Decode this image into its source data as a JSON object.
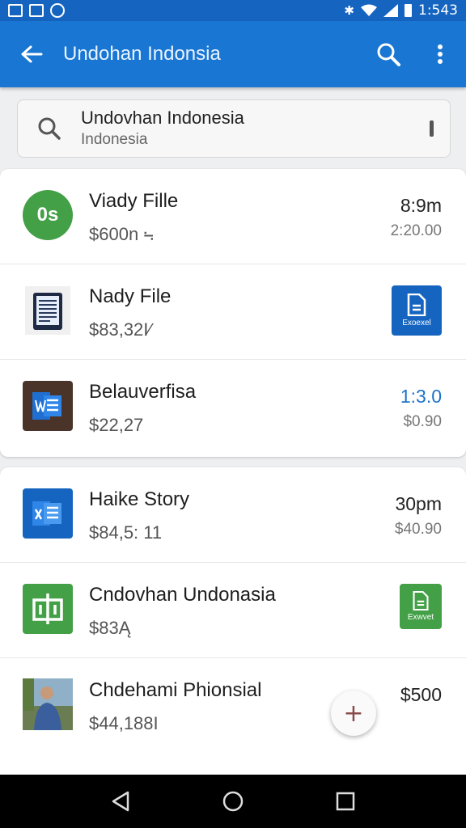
{
  "status_bar": {
    "time": "1:543",
    "left_icons": [
      "gallery-icon",
      "photo-icon",
      "app-icon"
    ],
    "right_icons": [
      "bluetooth-icon",
      "wifi-icon",
      "signal-icon",
      "battery-icon"
    ]
  },
  "app_bar": {
    "title": "Undohan Indonsia",
    "color": "#1976d2"
  },
  "search": {
    "query": "Undovhan Indonesia",
    "subtitle": "Indonesia"
  },
  "list_1": [
    {
      "title": "Viady Fille",
      "price": "$600n ⨫",
      "right_top": "8:9m",
      "right_bottom": "2:20.00",
      "thumb": "green-circle-icon",
      "thumb_text": "0s"
    },
    {
      "title": "Nady File",
      "price": "$83,32I∕",
      "badge_text": "Exoexel",
      "thumb": "document-tablet-icon"
    },
    {
      "title": "Belauverfisa",
      "price": "$22,27",
      "right_top": "1:3.0",
      "right_bottom": "$0.90",
      "thumb": "word-doc-icon"
    }
  ],
  "list_2": [
    {
      "title": "Haike Story",
      "price": "$84,5: 11",
      "right_top": "30pm",
      "right_bottom": "$40.90",
      "thumb": "word-doc-icon"
    },
    {
      "title": "Cndovhan Undonasia",
      "price": "$83Ą",
      "badge_text": "Exwvet",
      "thumb": "green-app-icon"
    },
    {
      "title": "Chdehami Phionsial",
      "price": "$44,188I",
      "right_top": "$500",
      "thumb": "user-photo"
    }
  ],
  "fab_label": "+",
  "colors": {
    "primary": "#1976d2",
    "green": "#43a047",
    "blue_link": "#1e73c8"
  }
}
